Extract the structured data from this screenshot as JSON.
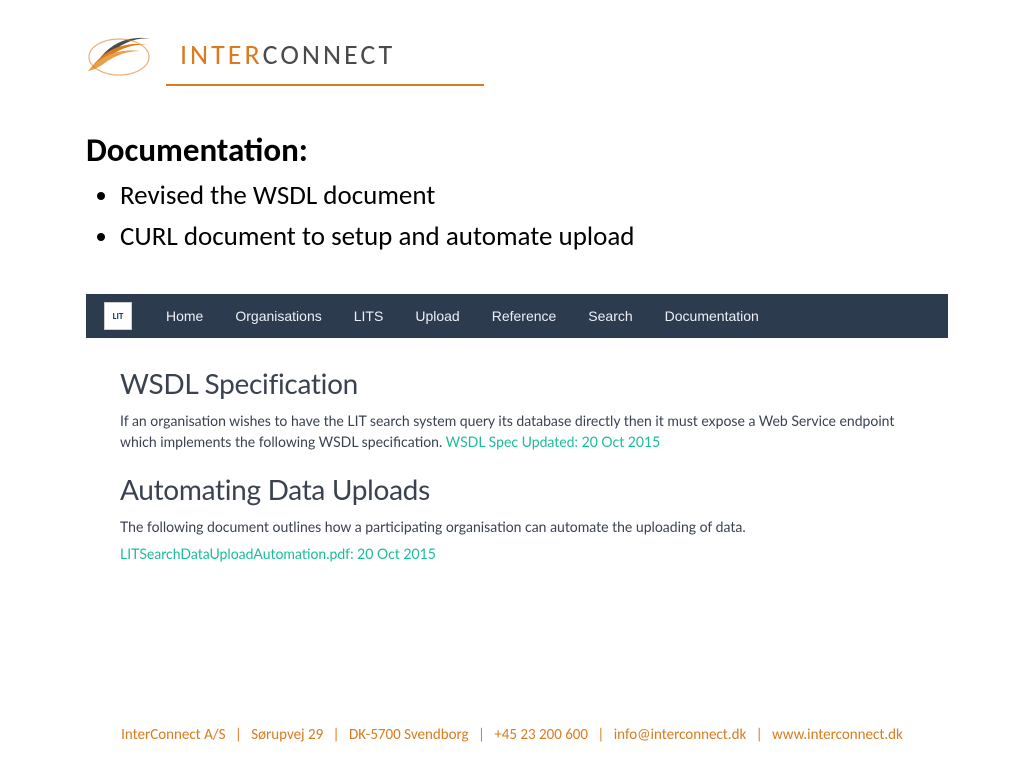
{
  "logo": {
    "text_left": "INTER",
    "text_right": "CONNECT"
  },
  "slide": {
    "title": "Documentation:",
    "bullets": [
      "Revised the WSDL document",
      "CURL document to setup and automate upload"
    ]
  },
  "embed": {
    "nav_logo": "LIT",
    "nav": [
      "Home",
      "Organisations",
      "LITS",
      "Upload",
      "Reference",
      "Search",
      "Documentation"
    ],
    "section1": {
      "heading": "WSDL Specification",
      "body": "If an organisation wishes to have the LIT search system query its database directly then it must expose a Web Service endpoint which implements the following WSDL specification. ",
      "link": "WSDL Spec Updated: 20 Oct 2015"
    },
    "section2": {
      "heading": "Automating Data Uploads",
      "body": "The following document outlines how a participating organisation can automate the uploading of data.",
      "link": "LITSearchDataUploadAutomation.pdf: 20 Oct 2015"
    }
  },
  "footer": {
    "company": "InterConnect A/S",
    "street": "Sørupvej 29",
    "city": "DK-5700 Svendborg",
    "phone": "+45 23 200 600",
    "email": "info@interconnect.dk",
    "web": "www.interconnect.dk",
    "sep": "|"
  }
}
